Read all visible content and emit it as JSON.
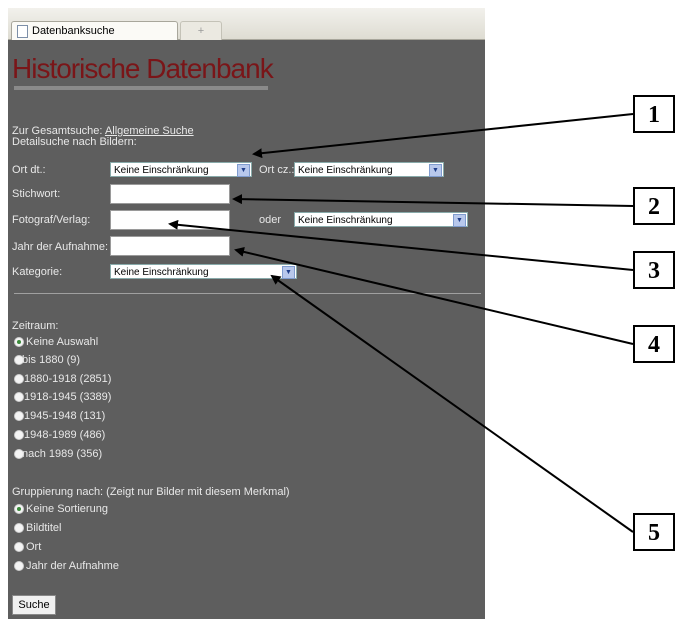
{
  "browser": {
    "tab_title": "Datenbanksuche",
    "new_tab": "+"
  },
  "logo": "Historische Datenbank",
  "intro": {
    "prefix": "Zur Gesamtsuche:",
    "link": "Allgemeine Suche",
    "detail": "Detailsuche nach Bildern:"
  },
  "form": {
    "ort_dt_label": "Ort dt.:",
    "ort_dt_value": "Keine Einschränkung",
    "ort_cz_label": "Ort cz.:",
    "ort_cz_value": "Keine Einschränkung",
    "stichwort_label": "Stichwort:",
    "stichwort_value": "",
    "fotograf_label": "Fotograf/Verlag:",
    "fotograf_value": "",
    "oder_label": "oder",
    "fotograf_select_value": "Keine Einschränkung",
    "jahr_label": "Jahr der Aufnahme:",
    "jahr_value": "",
    "kategorie_label": "Kategorie:",
    "kategorie_value": "Keine Einschränkung"
  },
  "zeitraum": {
    "label": "Zeitraum:",
    "options": [
      "Keine Auswahl",
      "bis 1880 (9)",
      "1880-1918 (2851)",
      "1918-1945 (3389)",
      "1945-1948 (131)",
      "1948-1989 (486)",
      "nach 1989 (356)"
    ],
    "selected": "Keine Auswahl"
  },
  "gruppierung": {
    "label": "Gruppierung nach: (Zeigt nur Bilder mit diesem Merkmal)",
    "options": [
      "Keine Sortierung",
      "Bildtitel",
      "Ort",
      "Jahr der Aufnahme"
    ],
    "selected": "Keine Sortierung"
  },
  "submit": "Suche",
  "callouts": [
    "1",
    "2",
    "3",
    "4",
    "5"
  ]
}
